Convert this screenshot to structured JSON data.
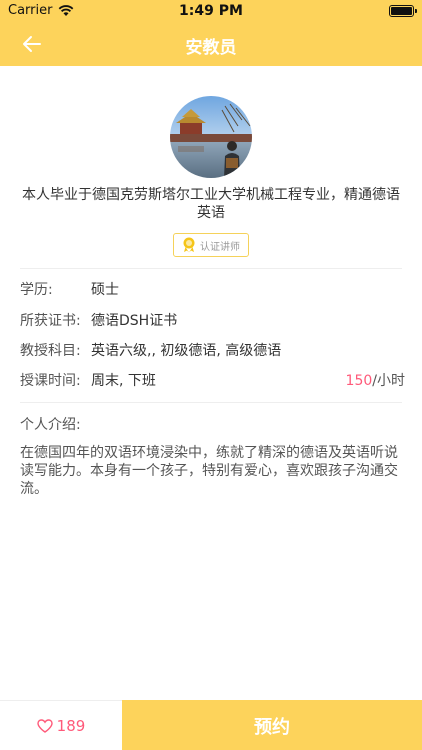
{
  "status_bar": {
    "carrier": "Carrier",
    "time": "1:49 PM"
  },
  "nav": {
    "title": "安教员"
  },
  "profile": {
    "bio": "本人毕业于德国克劳斯塔尔工业大学机械工程专业，精通德语英语",
    "badge_label": "认证讲师"
  },
  "info": {
    "education_label": "学历:",
    "education_value": "硕士",
    "certificate_label": "所获证书:",
    "certificate_value": "德语DSH证书",
    "subjects_label": "教授科目:",
    "subjects_value": "英语六级,, 初级德语, 高级德语",
    "schedule_label": "授课时间:",
    "schedule_value": "周末, 下班",
    "price_value": "150",
    "price_unit": "/小时"
  },
  "intro": {
    "title": "个人介绍:",
    "text": "在德国四年的双语环境浸染中，练就了精深的德语及英语听说读写能力。本身有一个孩子，特别有爱心，喜欢跟孩子沟通交流。"
  },
  "bottom": {
    "like_count": "189",
    "book_label": "预约"
  },
  "colors": {
    "accent": "#fdd35b",
    "price": "#ff5a7a",
    "badge_border": "#f5d25a"
  }
}
